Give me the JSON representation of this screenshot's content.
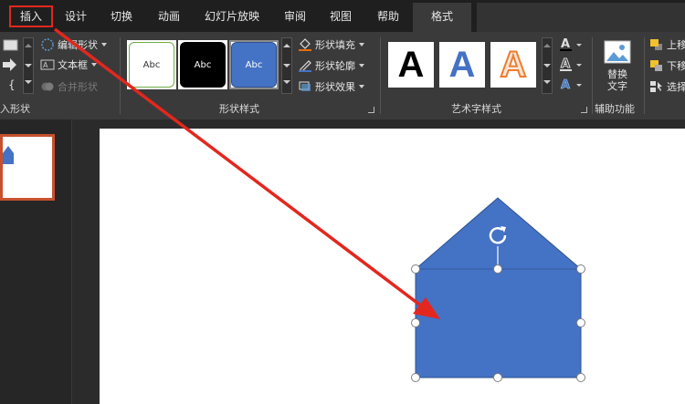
{
  "tabs": [
    {
      "label": "插入",
      "boxed": true
    },
    {
      "label": "设计"
    },
    {
      "label": "切换"
    },
    {
      "label": "动画"
    },
    {
      "label": "幻灯片放映"
    },
    {
      "label": "审阅"
    },
    {
      "label": "视图"
    },
    {
      "label": "帮助"
    },
    {
      "label": "格式",
      "active": true
    }
  ],
  "insert_shapes_group": {
    "edit_shape": "编辑形状",
    "text_box": "文本框",
    "merge_shapes": "合并形状",
    "label": "入形状"
  },
  "shape_styles_group": {
    "swatches": [
      "Abc",
      "Abc",
      "Abc"
    ],
    "fill": "形状填充",
    "outline": "形状轮廓",
    "effects": "形状效果",
    "label": "形状样式"
  },
  "wordart_group": {
    "samples": [
      "A",
      "A",
      "A"
    ],
    "label": "艺术字样式"
  },
  "accessibility_group": {
    "alt_text_line1": "替换",
    "alt_text_line2": "文字",
    "label": "辅助功能"
  },
  "arrange_group": {
    "bring_forward": "上移",
    "send_backward": "下移",
    "selection": "选择"
  },
  "colors": {
    "shape_fill": "#4472c4",
    "shape_stroke": "#2f528f",
    "annotation_red": "#e3271e",
    "accent_orange": "#c7512e"
  }
}
